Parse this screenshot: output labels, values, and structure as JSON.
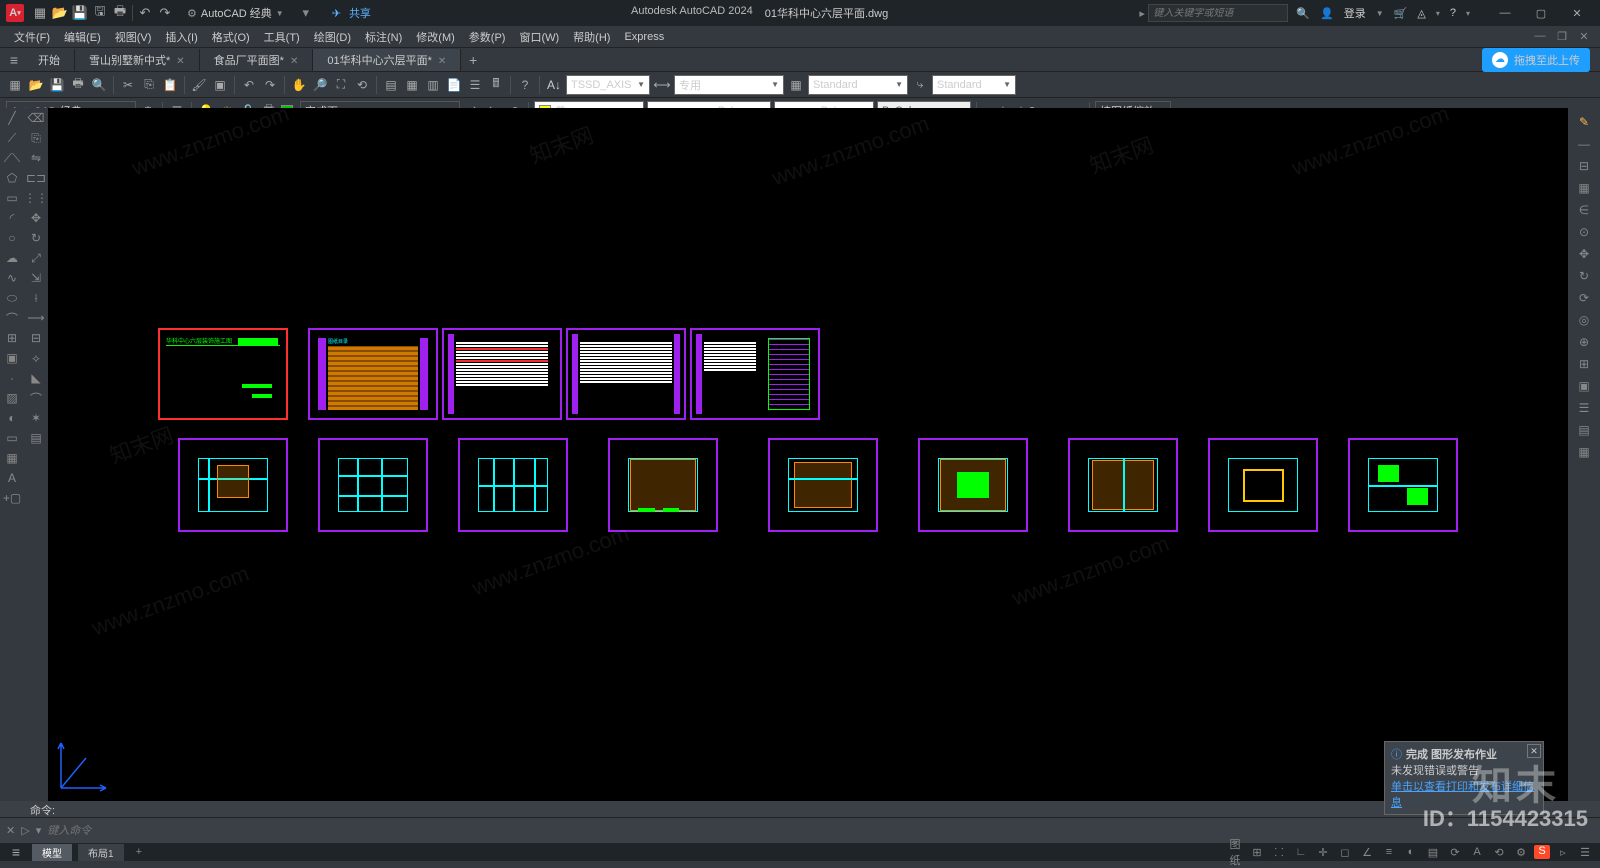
{
  "titlebar": {
    "app_letter": "A",
    "workspace": "AutoCAD 经典",
    "share": "共享",
    "app_name": "Autodesk AutoCAD 2024",
    "doc_name": "01华科中心六层平面.dwg",
    "search_placeholder": "键入关键字或短语",
    "login": "登录"
  },
  "menus": {
    "file": "文件(F)",
    "edit": "编辑(E)",
    "view": "视图(V)",
    "insert": "插入(I)",
    "format": "格式(O)",
    "tools": "工具(T)",
    "draw": "绘图(D)",
    "dim": "标注(N)",
    "modify": "修改(M)",
    "param": "参数(P)",
    "window": "窗口(W)",
    "help": "帮助(H)",
    "express": "Express"
  },
  "tabs": {
    "start": "开始",
    "t1": "雪山别墅新中式*",
    "t2": "食品厂平面图*",
    "t3": "01华科中心六层平面*",
    "upload": "拖拽至此上传"
  },
  "row1": {
    "textstyle": "TSSD_AXIS",
    "dimstyle": "专用",
    "tablestyle": "Standard",
    "mlstyle": "Standard"
  },
  "row2": {
    "workspace": "AutoCAD 经典",
    "layer": "完成面",
    "color": "黄",
    "ltype": "ByLayer",
    "lweight": "ByLayer",
    "plotstyle": "ByColor",
    "annoscale": "按图纸缩放"
  },
  "cmd": {
    "hist": "命令:",
    "hist2": "命令:",
    "placeholder": "键入命令"
  },
  "status": {
    "model": "模型",
    "layout1": "布局1",
    "paper": "图纸"
  },
  "notif": {
    "title": "完成 图形发布作业",
    "line2": "未发现错误或警告",
    "link": "单击以查看打印和发布详细信息"
  },
  "watermark": {
    "url": "www.znzmo.com",
    "cn": "知末网",
    "brand": "知末",
    "id": "ID：1154423315"
  }
}
